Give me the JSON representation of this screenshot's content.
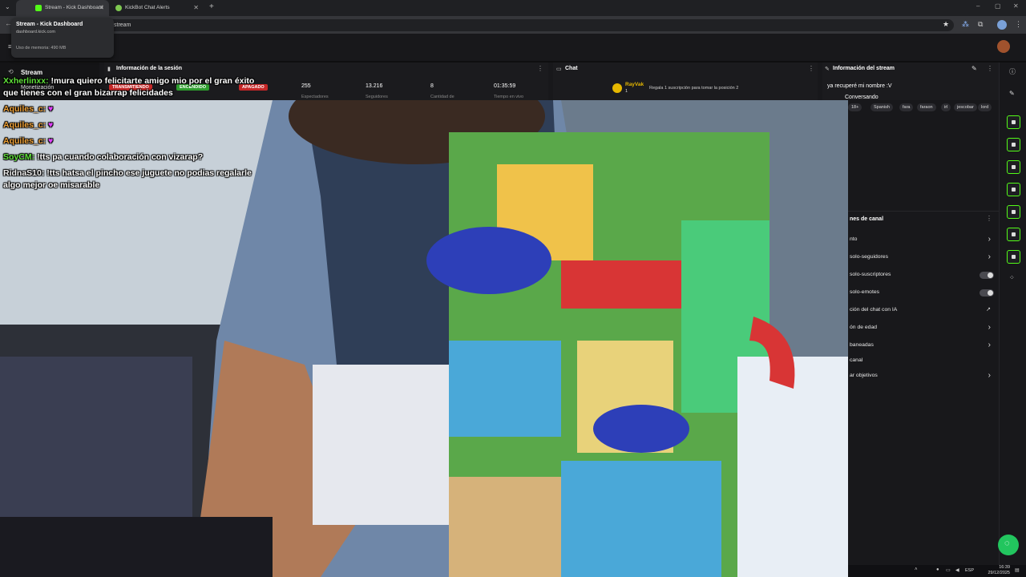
{
  "browser": {
    "tabs": [
      {
        "label": "Stream - Kick Dashboard",
        "active": true
      },
      {
        "label": "KickBot Chat Alerts",
        "active": false
      }
    ],
    "address": "stream",
    "tooltip": {
      "title": "Stream - Kick Dashboard",
      "domain": "dashboard.kick.com",
      "memory": "Uso de memoria: 490 MB"
    }
  },
  "dashboard": {
    "stream_label": "Stream",
    "monetization_label": "Monetización",
    "session": {
      "title": "Información de la sesión",
      "badges": [
        "TRANSMITIENDO",
        "ENCENDIDO",
        "APAGADO"
      ],
      "stats": [
        {
          "value": "255",
          "label": "Espectadores"
        },
        {
          "value": "13.216",
          "label": "Seguidores"
        },
        {
          "value": "8",
          "label": "Cantidad de"
        },
        {
          "value": "01:35:59",
          "label": "Tiempo en vivo"
        }
      ]
    },
    "chat": {
      "title": "Chat",
      "top_user": "RayVak",
      "top_user_count": "1",
      "gift_note": "Regala 1 suscripción para tomar la posición 2"
    },
    "stream_info": {
      "title": "Información del stream",
      "stream_title": "ya recuperé mi nombre :V",
      "category": "Conversando",
      "tags": [
        "18+",
        "Spanish",
        "fara",
        "faraon",
        "irl",
        "jescobar",
        "lord"
      ]
    },
    "channel_options": {
      "title": "nes de canal",
      "rows": [
        {
          "label": "nto",
          "control": "arrow"
        },
        {
          "label": "solo-seguidores",
          "control": "arrow"
        },
        {
          "label": "solo-suscriptores",
          "control": "toggle"
        },
        {
          "label": "solo-emotes",
          "control": "toggle"
        },
        {
          "label": "ción del chat con IA",
          "control": "external"
        },
        {
          "label": "ón de edad",
          "control": "arrow"
        },
        {
          "label": " baneadas",
          "control": "arrow"
        },
        {
          "label": "canal",
          "control": "none"
        },
        {
          "label": "ar objetivos",
          "control": "arrow"
        }
      ]
    }
  },
  "chat_overlay": [
    {
      "user": "Xxherlinxx:",
      "text": " !mura quiero felicitarte amigo mio por el gran éxito",
      "color": "user-g"
    },
    {
      "user": "",
      "text": "que tienes con el gran bizarrap felicidades",
      "color": "user-w"
    },
    {
      "user": "Aquiles_c:",
      "text": " ♥",
      "color": "user-o"
    },
    {
      "user": "Aquiles_c:",
      "text": " ♥",
      "color": "user-o"
    },
    {
      "user": "Aquiles_c:",
      "text": " ♥",
      "color": "user-o"
    },
    {
      "user": "SoyCM:",
      "text": " !tts pa cuando colaboración con vizarap?",
      "color": "user-g"
    },
    {
      "user": "RidnaS10:",
      "text": " !tts hatsa el pincho ese juguete no podias regalarle",
      "color": "user-w"
    },
    {
      "user": "",
      "text": "algo mejor oe misarable",
      "color": "user-w"
    }
  ],
  "taskbar": {
    "lang": "ESP",
    "time": "16:39",
    "date": "29/12/2025"
  },
  "colors": {
    "kick_green": "#53fc18",
    "live_red": "#e53935",
    "on_green": "#22c55e"
  }
}
